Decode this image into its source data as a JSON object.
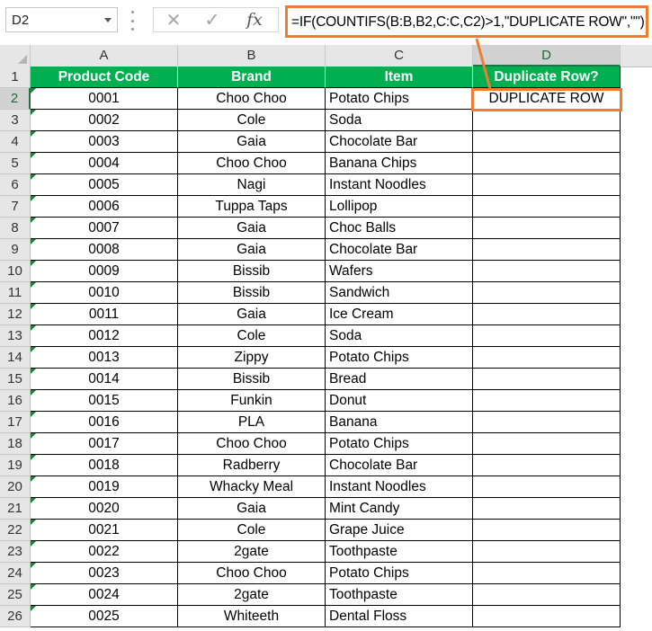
{
  "name_box": {
    "value": "D2"
  },
  "formula_bar": {
    "cancel_icon": "✕",
    "enter_icon": "✓",
    "fx_label": "fx",
    "formula": "=IF(COUNTIFS(B:B,B2,C:C,C2)>1,\"DUPLICATE ROW\",\"\")"
  },
  "columns": [
    "A",
    "B",
    "C",
    "D"
  ],
  "selected_column": "D",
  "selected_row": 2,
  "header_row": {
    "row_number": "1",
    "cells": [
      "Product Code",
      "Brand",
      "Item",
      "Duplicate Row?"
    ]
  },
  "rows": [
    {
      "n": "2",
      "code": "0001",
      "brand": "Choo Choo",
      "item": "Potato Chips",
      "dup": "DUPLICATE ROW"
    },
    {
      "n": "3",
      "code": "0002",
      "brand": "Cole",
      "item": "Soda",
      "dup": ""
    },
    {
      "n": "4",
      "code": "0003",
      "brand": "Gaia",
      "item": "Chocolate Bar",
      "dup": ""
    },
    {
      "n": "5",
      "code": "0004",
      "brand": "Choo Choo",
      "item": "Banana Chips",
      "dup": ""
    },
    {
      "n": "6",
      "code": "0005",
      "brand": "Nagi",
      "item": "Instant Noodles",
      "dup": ""
    },
    {
      "n": "7",
      "code": "0006",
      "brand": "Tuppa Taps",
      "item": "Lollipop",
      "dup": ""
    },
    {
      "n": "8",
      "code": "0007",
      "brand": "Gaia",
      "item": "Choc Balls",
      "dup": ""
    },
    {
      "n": "9",
      "code": "0008",
      "brand": "Gaia",
      "item": "Chocolate Bar",
      "dup": ""
    },
    {
      "n": "10",
      "code": "0009",
      "brand": "Bissib",
      "item": "Wafers",
      "dup": ""
    },
    {
      "n": "11",
      "code": "0010",
      "brand": "Bissib",
      "item": "Sandwich",
      "dup": ""
    },
    {
      "n": "12",
      "code": "0011",
      "brand": "Gaia",
      "item": "Ice Cream",
      "dup": ""
    },
    {
      "n": "13",
      "code": "0012",
      "brand": "Cole",
      "item": "Soda",
      "dup": ""
    },
    {
      "n": "14",
      "code": "0013",
      "brand": "Zippy",
      "item": "Potato Chips",
      "dup": ""
    },
    {
      "n": "15",
      "code": "0014",
      "brand": "Bissib",
      "item": "Bread",
      "dup": ""
    },
    {
      "n": "16",
      "code": "0015",
      "brand": "Funkin",
      "item": "Donut",
      "dup": ""
    },
    {
      "n": "17",
      "code": "0016",
      "brand": "PLA",
      "item": "Banana",
      "dup": ""
    },
    {
      "n": "18",
      "code": "0017",
      "brand": "Choo Choo",
      "item": "Potato Chips",
      "dup": ""
    },
    {
      "n": "19",
      "code": "0018",
      "brand": "Radberry",
      "item": "Chocolate Bar",
      "dup": ""
    },
    {
      "n": "20",
      "code": "0019",
      "brand": "Whacky Meal",
      "item": "Instant Noodles",
      "dup": ""
    },
    {
      "n": "21",
      "code": "0020",
      "brand": "Gaia",
      "item": "Mint Candy",
      "dup": ""
    },
    {
      "n": "22",
      "code": "0021",
      "brand": "Cole",
      "item": "Grape Juice",
      "dup": ""
    },
    {
      "n": "23",
      "code": "0022",
      "brand": "2gate",
      "item": "Toothpaste",
      "dup": ""
    },
    {
      "n": "24",
      "code": "0023",
      "brand": "Choo Choo",
      "item": "Potato Chips",
      "dup": ""
    },
    {
      "n": "25",
      "code": "0024",
      "brand": "2gate",
      "item": "Toothpaste",
      "dup": ""
    },
    {
      "n": "26",
      "code": "0025",
      "brand": "Whiteeth",
      "item": "Dental Floss",
      "dup": ""
    }
  ],
  "colors": {
    "header_fill": "#00B050",
    "highlight": "#ED7D31",
    "excel_green": "#217346"
  }
}
